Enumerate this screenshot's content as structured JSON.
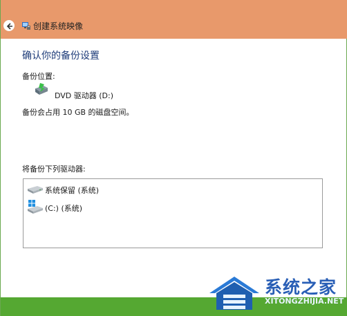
{
  "window": {
    "title": "创建系统映像"
  },
  "colors": {
    "titlebar": "#e8996b",
    "heading": "#1f3d7a",
    "bottom_band": "#55a832"
  },
  "main": {
    "heading": "确认你的备份设置",
    "backup_location_label": "备份位置:",
    "backup_location_value": "DVD 驱动器 (D:)",
    "usage_text": "备份会占用 10 GB 的磁盘空间。",
    "drives_label": "将备份下列驱动器:",
    "drives": [
      {
        "label": "系统保留 (系统)",
        "icon": "hard-drive-icon"
      },
      {
        "label": "(C:) (系统)",
        "icon": "windows-drive-icon"
      }
    ]
  },
  "watermark": {
    "brand": "系统之家",
    "url": "XITONGZHIJIA.NET"
  }
}
